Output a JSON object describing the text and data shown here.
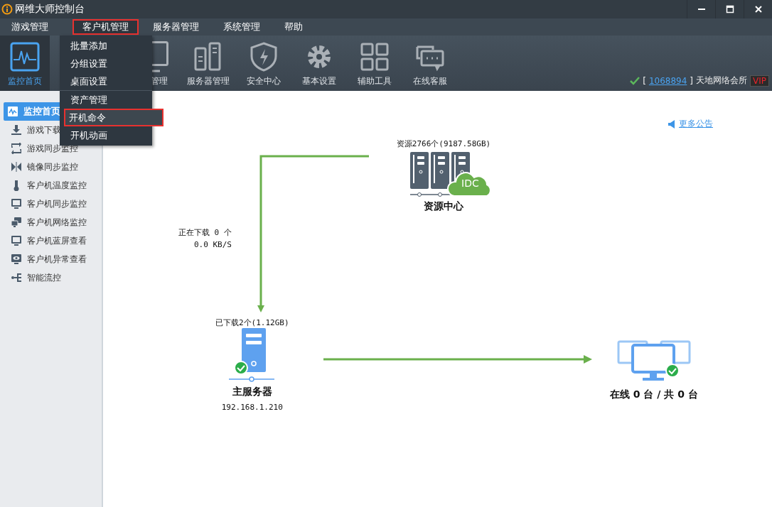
{
  "window": {
    "title": "网维大师控制台"
  },
  "menubar": [
    {
      "label": "游戏管理",
      "selected": false,
      "highlighted": false
    },
    {
      "label": "客户机管理",
      "selected": true,
      "highlighted": true
    },
    {
      "label": "服务器管理",
      "selected": false,
      "highlighted": false
    },
    {
      "label": "系统管理",
      "selected": false,
      "highlighted": false
    },
    {
      "label": "帮助",
      "selected": false,
      "highlighted": false
    }
  ],
  "dropdown": [
    {
      "label": "批量添加",
      "highlighted": false,
      "divider_after": false
    },
    {
      "label": "分组设置",
      "highlighted": false,
      "divider_after": false
    },
    {
      "label": "桌面设置",
      "highlighted": false,
      "divider_after": true
    },
    {
      "label": "资产管理",
      "highlighted": false,
      "divider_after": false
    },
    {
      "label": "开机命令",
      "highlighted": true,
      "divider_after": false
    },
    {
      "label": "开机动画",
      "highlighted": false,
      "divider_after": false
    }
  ],
  "toolbar": [
    {
      "kind": "monitor",
      "label": "监控首页",
      "selected": true
    },
    {
      "kind": "client",
      "label": "管理",
      "selected": false
    },
    {
      "kind": "server",
      "label": "服务器管理",
      "selected": false
    },
    {
      "kind": "shield",
      "label": "安全中心",
      "selected": false
    },
    {
      "kind": "gear",
      "label": "基本设置",
      "selected": false
    },
    {
      "kind": "grid",
      "label": "辅助工具",
      "selected": false
    },
    {
      "kind": "chat",
      "label": "在线客服",
      "selected": false
    }
  ],
  "account": {
    "open_bracket": "[",
    "id": "1068894",
    "close_bracket": "]",
    "name": "天地网络会所",
    "badge": "VIP"
  },
  "sidebar": [
    {
      "kind": "monitor",
      "label": "监控首页",
      "selected": true
    },
    {
      "kind": "download",
      "label": "游戏下载",
      "selected": false
    },
    {
      "kind": "sync",
      "label": "游戏同步监控",
      "selected": false
    },
    {
      "kind": "mirror",
      "label": "镜像同步监控",
      "selected": false
    },
    {
      "kind": "temp",
      "label": "客户机温度监控",
      "selected": false
    },
    {
      "kind": "screen",
      "label": "客户机同步监控",
      "selected": false
    },
    {
      "kind": "network",
      "label": "客户机网络监控",
      "selected": false
    },
    {
      "kind": "bluescreen",
      "label": "客户机蓝屏查看",
      "selected": false
    },
    {
      "kind": "eye",
      "label": "客户机异常查看",
      "selected": false
    },
    {
      "kind": "flow",
      "label": "智能流控",
      "selected": false
    }
  ],
  "announcement_link": "更多公告",
  "diagram": {
    "resource_center": {
      "summary": "资源2766个(9187.58GB)",
      "title": "资源中心",
      "badge": "IDC"
    },
    "downloading": {
      "count": "正在下载 0 个",
      "speed": "0.0 KB/S"
    },
    "main_server": {
      "summary": "已下载2个(1.12GB)",
      "title": "主服务器",
      "ip": "192.168.1.210",
      "online": true
    },
    "clients": {
      "status": "在线 0 台 / 共 0 台",
      "online": true
    }
  }
}
